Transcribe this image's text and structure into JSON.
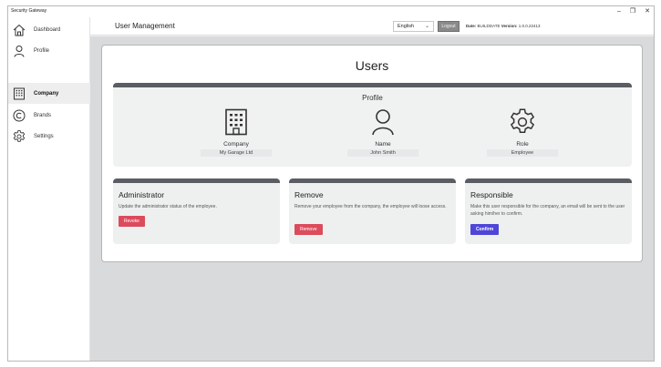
{
  "window": {
    "title": "Security Gateway",
    "controls": [
      "–",
      "❐",
      "✕"
    ]
  },
  "sidebar": {
    "items": [
      {
        "label": "Dashboard",
        "icon": "home-icon",
        "active": false
      },
      {
        "label": "Profile",
        "icon": "person-icon",
        "active": false
      },
      {
        "label": "Company",
        "icon": "building-icon",
        "active": true
      },
      {
        "label": "Brands",
        "icon": "copyright-icon",
        "active": false
      },
      {
        "label": "Settings",
        "icon": "gear-icon",
        "active": false
      }
    ]
  },
  "header": {
    "title": "User Management",
    "language": "English",
    "logout_label": "Logout",
    "date_label": "Date:",
    "date_value": "BUILDDATE",
    "version_label": "Version:",
    "version_value": "1.0.0.22413"
  },
  "main": {
    "title": "Users",
    "profile": {
      "title": "Profile",
      "company_label": "Company",
      "company_value": "My Garage Ltd",
      "name_label": "Name",
      "name_value": "John Smith",
      "role_label": "Role",
      "role_value": "Employee"
    },
    "actions": {
      "administrator": {
        "title": "Administrator",
        "description": "Update the administrator status of the employee.",
        "button": "Revoke"
      },
      "remove": {
        "title": "Remove",
        "description": "Remove your employee from the company, the employee will loose access.",
        "button": "Remove"
      },
      "responsible": {
        "title": "Responsible",
        "description": "Make this user responsible for the company, an email will be sent to the user asking him/her to confirm.",
        "button": "Confirm"
      }
    }
  },
  "colors": {
    "accent_red": "#dc4b5c",
    "accent_blue": "#4f46d8",
    "panel_header": "#5a5e62"
  }
}
